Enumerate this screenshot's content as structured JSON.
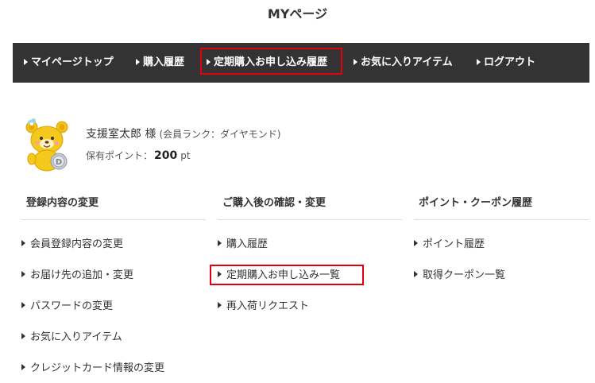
{
  "page": {
    "title": "MYページ"
  },
  "nav": {
    "items": [
      {
        "label": "マイページトップ"
      },
      {
        "label": "購入履歴"
      },
      {
        "label": "定期購入お申し込み履歴"
      },
      {
        "label": "お気に入りアイテム"
      },
      {
        "label": "ログアウト"
      }
    ],
    "highlight_color": "#e0000e",
    "background_color": "#333333"
  },
  "user": {
    "name": "支援室太郎 様",
    "rank": "(会員ランク：ダイヤモンド)",
    "points_label": "保有ポイント：",
    "points_value": "200",
    "points_unit": "pt",
    "avatar_badge": "D",
    "avatar_icon": "bear-mascot-icon"
  },
  "sections": [
    {
      "title": "登録内容の変更",
      "links": [
        {
          "label": "会員登録内容の変更"
        },
        {
          "label": "お届け先の追加・変更"
        },
        {
          "label": "パスワードの変更"
        },
        {
          "label": "お気に入りアイテム"
        },
        {
          "label": "クレジットカード情報の変更"
        }
      ]
    },
    {
      "title": "ご購入後の確認・変更",
      "links": [
        {
          "label": "購入履歴"
        },
        {
          "label": "定期購入お申し込み一覧"
        },
        {
          "label": "再入荷リクエスト"
        }
      ]
    },
    {
      "title": "ポイント・クーポン履歴",
      "links": [
        {
          "label": "ポイント履歴"
        },
        {
          "label": "取得クーポン一覧"
        }
      ]
    }
  ]
}
